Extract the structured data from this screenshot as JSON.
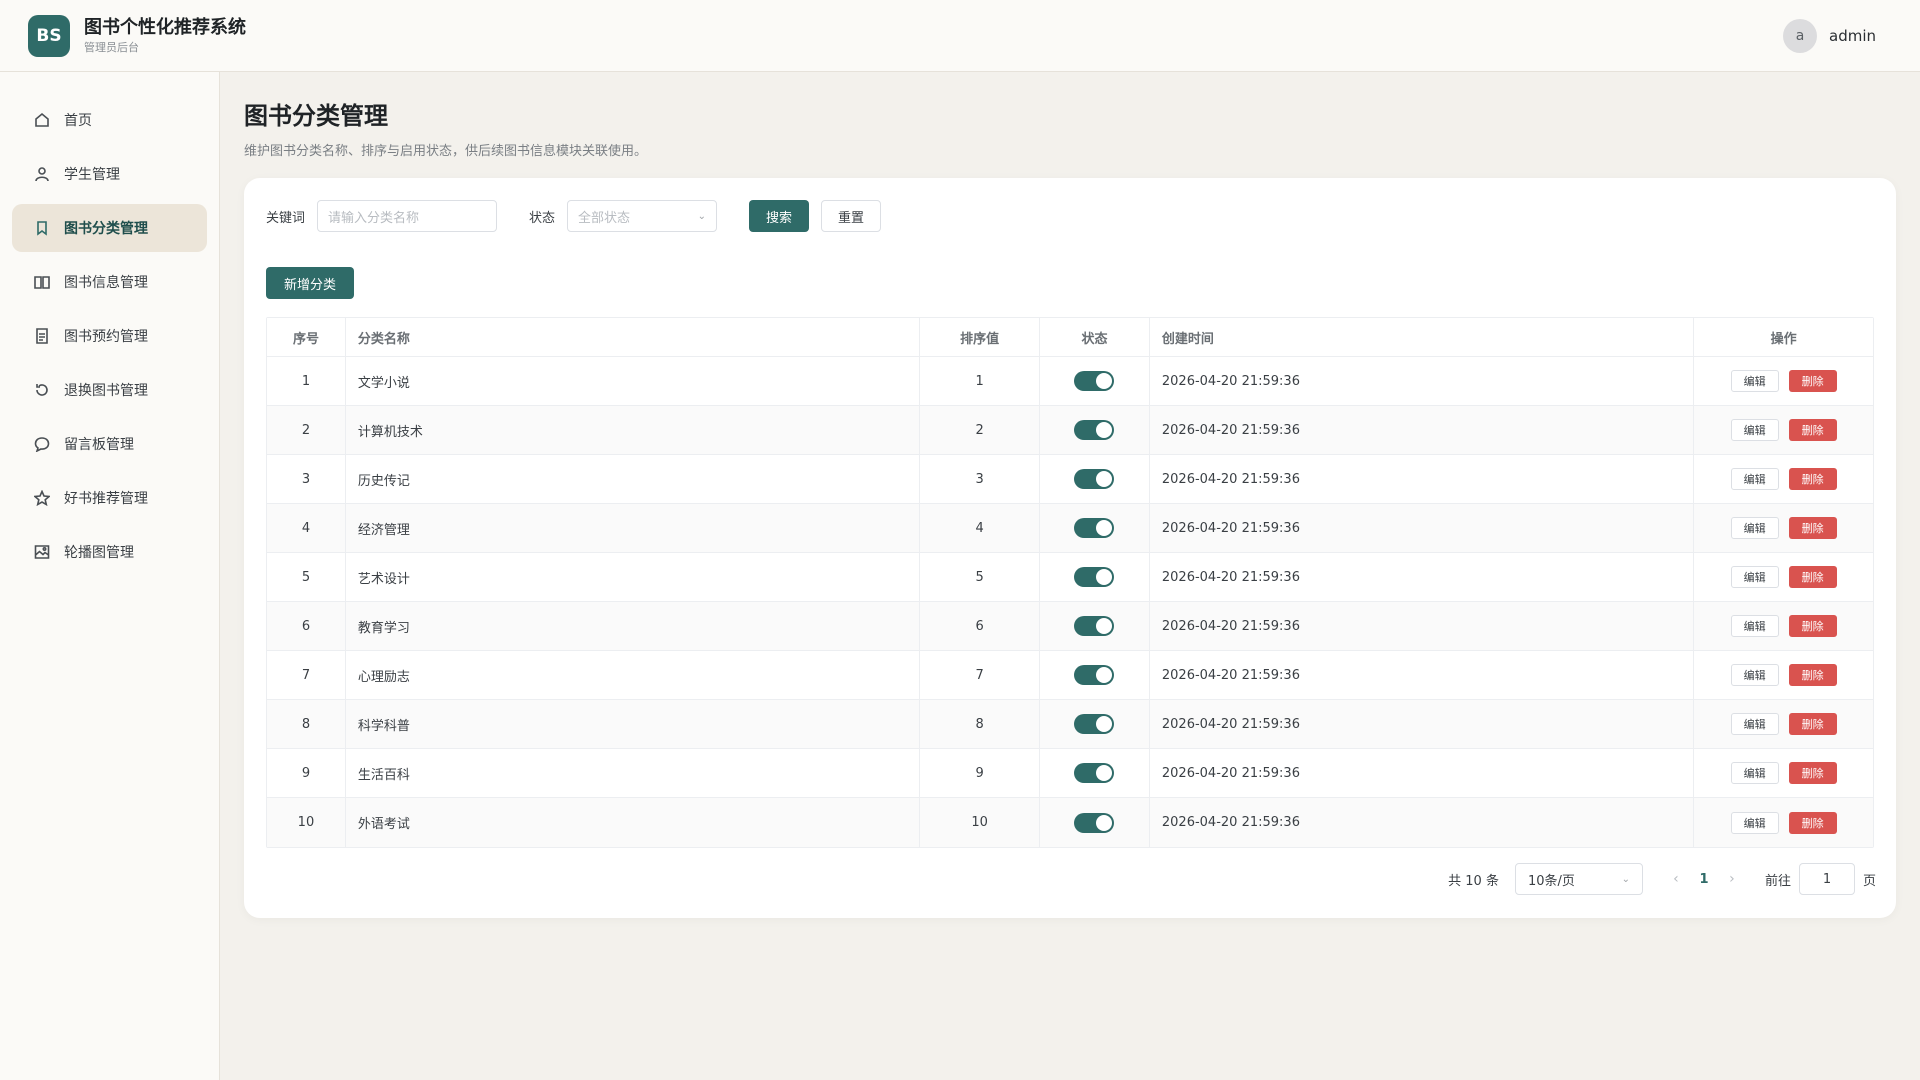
{
  "header": {
    "logo_text": "BS",
    "app_title": "图书个性化推荐系统",
    "app_subtitle": "管理员后台",
    "avatar_letter": "a",
    "username": "admin"
  },
  "sidebar": {
    "items": [
      {
        "label": "首页",
        "icon": "home-icon"
      },
      {
        "label": "学生管理",
        "icon": "user-icon"
      },
      {
        "label": "图书分类管理",
        "icon": "bookmark-icon",
        "active": true
      },
      {
        "label": "图书信息管理",
        "icon": "book-open-icon"
      },
      {
        "label": "图书预约管理",
        "icon": "document-icon"
      },
      {
        "label": "退换图书管理",
        "icon": "refresh-icon"
      },
      {
        "label": "留言板管理",
        "icon": "message-icon"
      },
      {
        "label": "好书推荐管理",
        "icon": "star-icon"
      },
      {
        "label": "轮播图管理",
        "icon": "image-icon"
      }
    ]
  },
  "page": {
    "title": "图书分类管理",
    "description": "维护图书分类名称、排序与启用状态，供后续图书信息模块关联使用。"
  },
  "filters": {
    "keyword_label": "关键词",
    "keyword_placeholder": "请输入分类名称",
    "status_label": "状态",
    "status_value": "全部状态",
    "search_label": "搜索",
    "reset_label": "重置"
  },
  "add_button_label": "新增分类",
  "table": {
    "headers": {
      "index": "序号",
      "name": "分类名称",
      "sort": "排序值",
      "status": "状态",
      "created": "创建时间",
      "ops": "操作"
    },
    "edit_label": "编辑",
    "delete_label": "删除",
    "rows": [
      {
        "index": "1",
        "name": "文学小说",
        "sort": "1",
        "enabled": true,
        "created": "2026-04-20 21:59:36"
      },
      {
        "index": "2",
        "name": "计算机技术",
        "sort": "2",
        "enabled": true,
        "created": "2026-04-20 21:59:36"
      },
      {
        "index": "3",
        "name": "历史传记",
        "sort": "3",
        "enabled": true,
        "created": "2026-04-20 21:59:36"
      },
      {
        "index": "4",
        "name": "经济管理",
        "sort": "4",
        "enabled": true,
        "created": "2026-04-20 21:59:36"
      },
      {
        "index": "5",
        "name": "艺术设计",
        "sort": "5",
        "enabled": true,
        "created": "2026-04-20 21:59:36"
      },
      {
        "index": "6",
        "name": "教育学习",
        "sort": "6",
        "enabled": true,
        "created": "2026-04-20 21:59:36"
      },
      {
        "index": "7",
        "name": "心理励志",
        "sort": "7",
        "enabled": true,
        "created": "2026-04-20 21:59:36"
      },
      {
        "index": "8",
        "name": "科学科普",
        "sort": "8",
        "enabled": true,
        "created": "2026-04-20 21:59:36"
      },
      {
        "index": "9",
        "name": "生活百科",
        "sort": "9",
        "enabled": true,
        "created": "2026-04-20 21:59:36"
      },
      {
        "index": "10",
        "name": "外语考试",
        "sort": "10",
        "enabled": true,
        "created": "2026-04-20 21:59:36"
      }
    ]
  },
  "pagination": {
    "total_text": "共 10 条",
    "page_size": "10条/页",
    "current_page": "1",
    "goto_label": "前往",
    "goto_value": "1",
    "page_suffix": "页"
  },
  "colors": {
    "accent": "#2f6b68",
    "danger": "#d9534f",
    "active_nav_bg": "#ece5d9"
  }
}
